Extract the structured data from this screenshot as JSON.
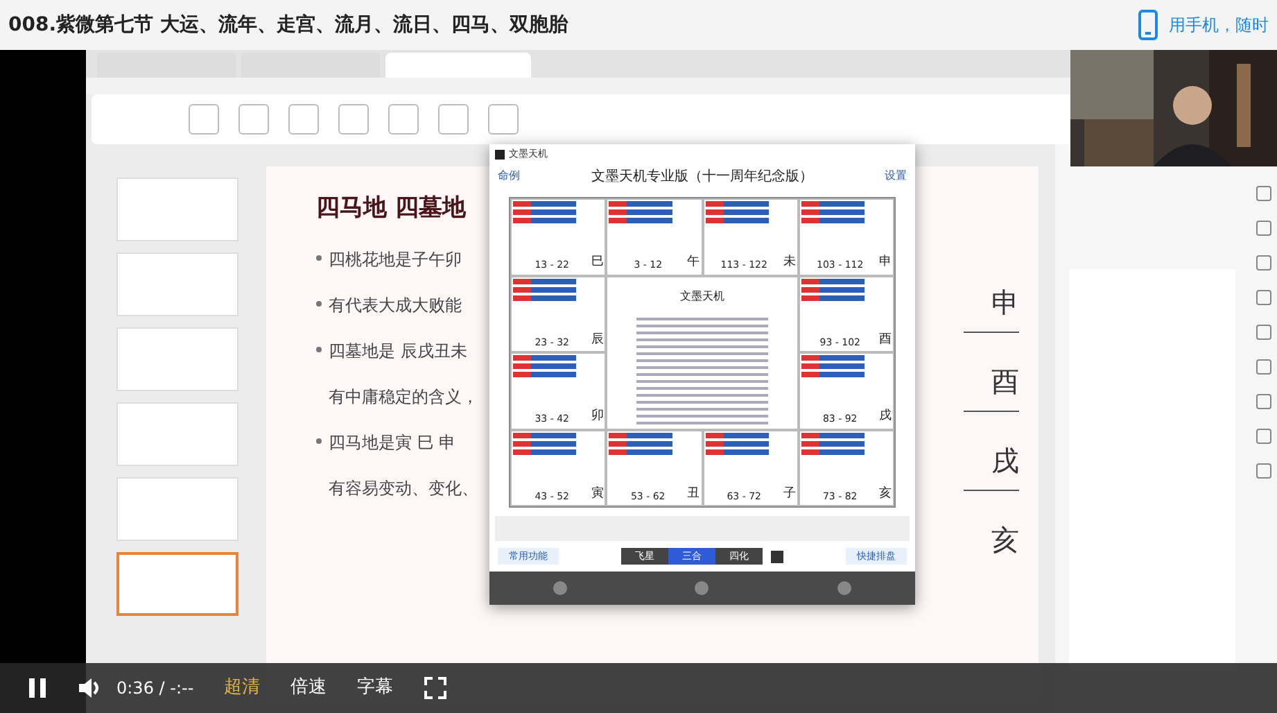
{
  "page_title": "008.紫微第七节 大运、流年、走宫、流月、流日、四马、双胞胎",
  "mobile_link": "用手机，随时",
  "slide": {
    "title": "四马地  四墓地",
    "lines": [
      {
        "text": "四桃花地是子午卯",
        "kind": "bullet"
      },
      {
        "text": "有代表大成大败能",
        "kind": "bullet"
      },
      {
        "text": "四墓地是 辰戌丑未",
        "kind": "bullet"
      },
      {
        "text": "有中庸稳定的含义，",
        "kind": "continued"
      },
      {
        "text": "四马地是寅 巳 申",
        "kind": "bullet"
      },
      {
        "text": "有容易变动、变化、",
        "kind": "continued"
      }
    ],
    "handwriting": [
      "申",
      "酉",
      "戌",
      "亥"
    ]
  },
  "app": {
    "window_title": "文墨天机",
    "back": "命例",
    "title": "文墨天机专业版（十一周年纪念版）",
    "settings": "设置",
    "palaces": [
      {
        "range": "13 - 22",
        "branch": "巳"
      },
      {
        "range": "3 - 12",
        "branch": "午"
      },
      {
        "range": "113 - 122",
        "branch": "未"
      },
      {
        "range": "103 - 112",
        "branch": "申"
      },
      {
        "range": "23 - 32",
        "branch": "辰"
      },
      {
        "range": "93 - 102",
        "branch": "酉"
      },
      {
        "range": "33 - 42",
        "branch": "卯"
      },
      {
        "range": "83 - 92",
        "branch": "戌"
      },
      {
        "range": "43 - 52",
        "branch": "寅"
      },
      {
        "range": "53 - 62",
        "branch": "丑"
      },
      {
        "range": "63 - 72",
        "branch": "子"
      },
      {
        "range": "73 - 82",
        "branch": "亥"
      }
    ],
    "center_title": "文墨天机",
    "common": "常用功能",
    "modes": [
      {
        "label": "飞星",
        "selected": false
      },
      {
        "label": "三合",
        "selected": true
      },
      {
        "label": "四化",
        "selected": false
      }
    ],
    "quick": "快捷排盘"
  },
  "player": {
    "playing": true,
    "time": "0:36 / -:--",
    "quality": "超清",
    "speed": "倍速",
    "subtitles": "字幕"
  }
}
